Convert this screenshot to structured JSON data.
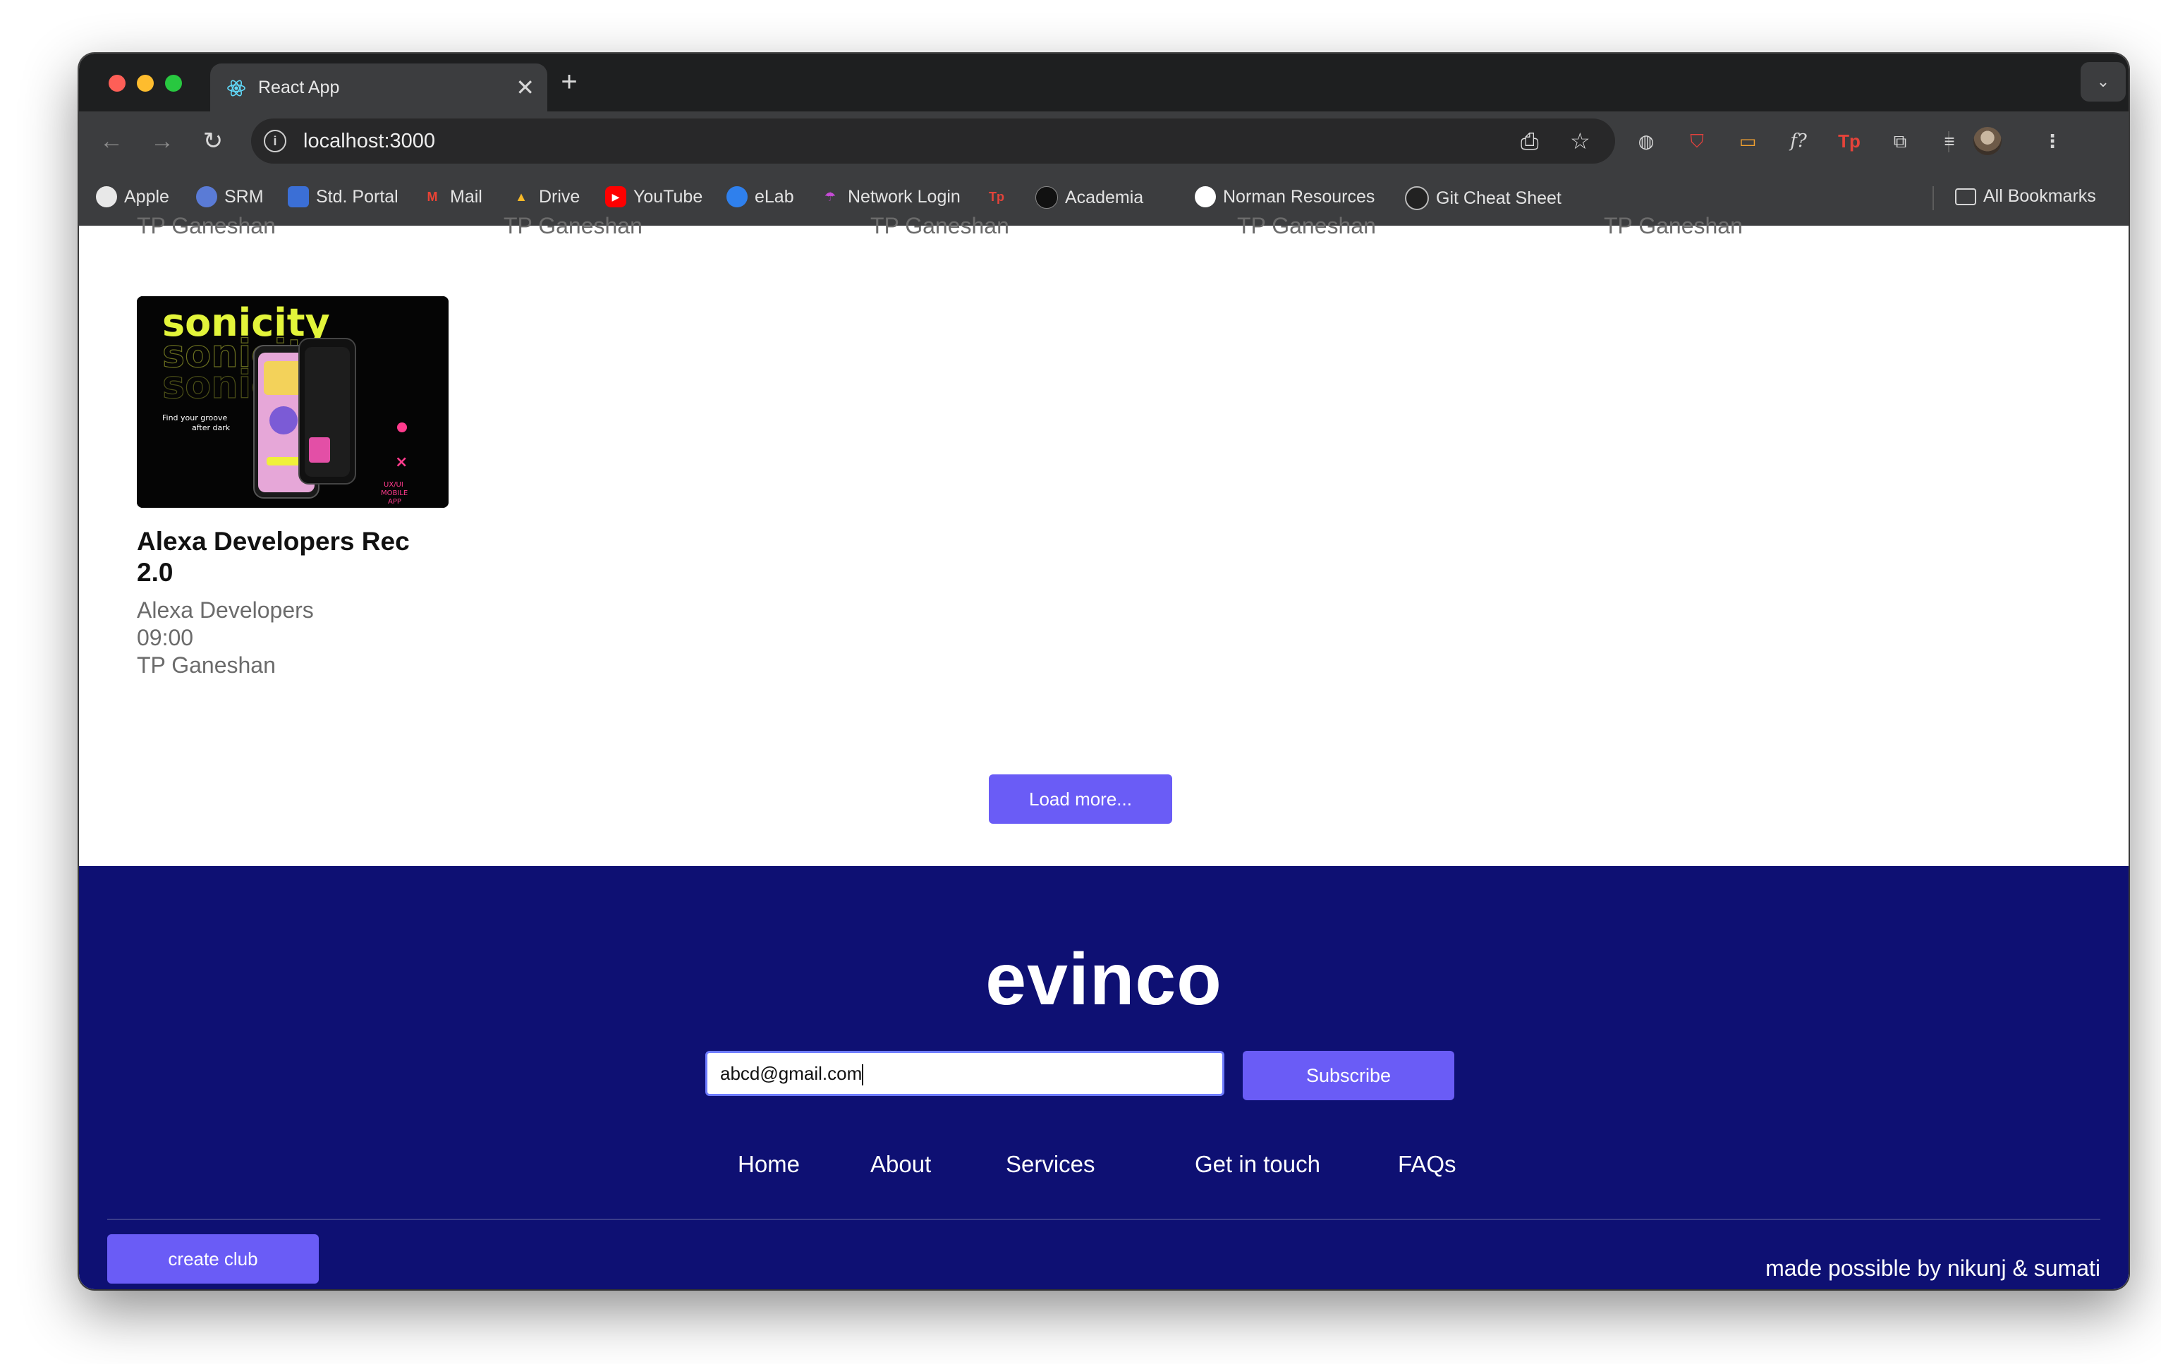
{
  "browser": {
    "tab_title": "React App",
    "tab_close": "✕",
    "new_tab": "+",
    "tab_menu": "⌄",
    "url": "localhost:3000",
    "bookmarks": [
      {
        "label": "Apple"
      },
      {
        "label": "SRM"
      },
      {
        "label": "Std. Portal"
      },
      {
        "label": "Mail"
      },
      {
        "label": "Drive"
      },
      {
        "label": "YouTube"
      },
      {
        "label": "eLab"
      },
      {
        "label": "Network Login"
      },
      {
        "label": ""
      },
      {
        "label": "Academia"
      },
      {
        "label": "Norman Resources"
      },
      {
        "label": "Git Cheat Sheet"
      }
    ],
    "all_bookmarks": "All Bookmarks"
  },
  "content": {
    "clipped_row_text": "TP Ganeshan",
    "card": {
      "image_title": "sonicity",
      "image_tagline": "Find your groove after dark",
      "image_badge": "UX/UI MOBILE APP",
      "title": "Alexa Developers Rec 2.0",
      "club": "Alexa Developers",
      "time": "09:00",
      "venue": "TP Ganeshan"
    },
    "load_more": "Load more..."
  },
  "footer": {
    "brand": "evinco",
    "email_value": "abcd@gmail.com",
    "subscribe": "Subscribe",
    "nav": [
      "Home",
      "About",
      "Services",
      "Get in touch",
      "FAQs"
    ],
    "create_club": "create club",
    "credit": "made possible by nikunj & sumati"
  }
}
